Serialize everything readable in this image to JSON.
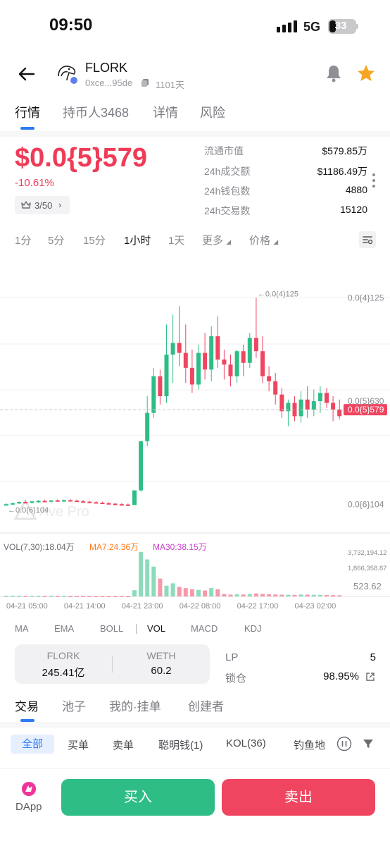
{
  "status_bar": {
    "time": "09:50",
    "network": "5G",
    "battery": "33"
  },
  "header": {
    "token_name": "FLORK",
    "address": "0xce...95de",
    "age": "1101天",
    "icons": {
      "back": "back-arrow-icon",
      "bell": "bell-icon",
      "star": "star-icon",
      "copy": "copy-icon"
    },
    "star_color": "#f5a623"
  },
  "tabs": [
    "行情",
    "持币人3468",
    "详情",
    "风险"
  ],
  "price": {
    "value": "$0.0{5}579",
    "change": "-10.61%",
    "rank": "3/50"
  },
  "stats": [
    {
      "label": "流通市值",
      "value": "$579.85万"
    },
    {
      "label": "24h成交额",
      "value": "$1186.49万"
    },
    {
      "label": "24h钱包数",
      "value": "4880"
    },
    {
      "label": "24h交易数",
      "value": "15120"
    }
  ],
  "intervals": [
    "1分",
    "5分",
    "15分",
    "1小时",
    "1天",
    "更多",
    "价格"
  ],
  "active_interval": "1小时",
  "chart_data": {
    "type": "candlestick",
    "watermark": "Ave Pro",
    "colors": {
      "up": "#2ebd85",
      "down": "#ef4560",
      "last_price": "#ef4560"
    },
    "price_axis_labels": [
      "0.0{4}125",
      "0.0{5}630",
      "0.0{6}104"
    ],
    "price_axis_values": [
      1.25e-05,
      6.3e-06,
      1.04e-07
    ],
    "price_range": [
      -1.1e-06,
      1.43e-05
    ],
    "last_price_label": "0.0{5}579",
    "last_price": 5.79e-06,
    "max_marker": "←0.0(4)125",
    "min_marker": "←0.0(6)104",
    "volume_legend": {
      "vol": "VOL(7,30):18.04万",
      "ma7": "MA7:24.36万",
      "ma30": "MA30:38.15万",
      "ma7_color": "#ff7a1a",
      "ma30_color": "#c840c8"
    },
    "volume_axis_labels": [
      "3,732,194.12",
      "1,866,358.87",
      "523.62"
    ],
    "volume_axis_values": [
      3732194.12,
      1866358.87,
      523.62
    ],
    "volume_max": 3900000,
    "x_labels": [
      "04-21 05:00",
      "04-21 14:00",
      "04-21 23:00",
      "04-22 08:00",
      "04-22 17:00",
      "04-23 02:00"
    ],
    "x_label_index": [
      0,
      9,
      18,
      27,
      36,
      45
    ],
    "candles": [
      {
        "o": 1.04e-07,
        "h": 1.8e-07,
        "l": 4e-08,
        "c": 1.2e-07,
        "v": 45000
      },
      {
        "o": 1.2e-07,
        "h": 2.2e-07,
        "l": 8e-08,
        "c": 1.8e-07,
        "v": 52000
      },
      {
        "o": 1.8e-07,
        "h": 2.8e-07,
        "l": 1.2e-07,
        "c": 2.5e-07,
        "v": 48000
      },
      {
        "o": 2.5e-07,
        "h": 3.3e-07,
        "l": 1.6e-07,
        "c": 2.1e-07,
        "v": 41000
      },
      {
        "o": 2.1e-07,
        "h": 3.2e-07,
        "l": 1.5e-07,
        "c": 2.9e-07,
        "v": 56000
      },
      {
        "o": 2.9e-07,
        "h": 3.7e-07,
        "l": 2.1e-07,
        "c": 3.2e-07,
        "v": 44000
      },
      {
        "o": 3.2e-07,
        "h": 3.9e-07,
        "l": 2.4e-07,
        "c": 2.7e-07,
        "v": 39000
      },
      {
        "o": 2.7e-07,
        "h": 3.7e-07,
        "l": 2e-07,
        "c": 3.5e-07,
        "v": 42000
      },
      {
        "o": 3.5e-07,
        "h": 4.1e-07,
        "l": 2.6e-07,
        "c": 3.1e-07,
        "v": 40000
      },
      {
        "o": 3.1e-07,
        "h": 4e-07,
        "l": 2.4e-07,
        "c": 3.6e-07,
        "v": 43000
      },
      {
        "o": 3.6e-07,
        "h": 4.2e-07,
        "l": 2.9e-07,
        "c": 3.3e-07,
        "v": 38000
      },
      {
        "o": 3.3e-07,
        "h": 4e-07,
        "l": 2.6e-07,
        "c": 3e-07,
        "v": 36000
      },
      {
        "o": 3e-07,
        "h": 3.6e-07,
        "l": 2.3e-07,
        "c": 2.7e-07,
        "v": 35000
      },
      {
        "o": 2.7e-07,
        "h": 3.3e-07,
        "l": 2e-07,
        "c": 2.4e-07,
        "v": 33000
      },
      {
        "o": 2.4e-07,
        "h": 3e-07,
        "l": 1.8e-07,
        "c": 2.1e-07,
        "v": 32000
      },
      {
        "o": 2.1e-07,
        "h": 2.7e-07,
        "l": 1.5e-07,
        "c": 1.8e-07,
        "v": 31000
      },
      {
        "o": 1.8e-07,
        "h": 2.4e-07,
        "l": 1.2e-07,
        "c": 1.5e-07,
        "v": 30000
      },
      {
        "o": 1.5e-07,
        "h": 2.1e-07,
        "l": 9e-08,
        "c": 1.2e-07,
        "v": 29000
      },
      {
        "o": 1.2e-07,
        "h": 1.8e-07,
        "l": 7e-08,
        "c": 9e-08,
        "v": 28000
      },
      {
        "o": 1e-07,
        "h": 1.6e-07,
        "l": 5e-08,
        "c": 7e-08,
        "v": 27000
      },
      {
        "o": 7e-08,
        "h": 1.3e-07,
        "l": 1.04e-07,
        "c": 9.5e-07,
        "v": 520000
      },
      {
        "o": 9.5e-07,
        "h": 1.4e-06,
        "l": 8.7e-07,
        "c": 3.9e-06,
        "v": 3732194
      },
      {
        "o": 3.9e-06,
        "h": 6.6e-06,
        "l": 3.6e-06,
        "c": 5.6e-06,
        "v": 3100000
      },
      {
        "o": 5.6e-06,
        "h": 8.3e-06,
        "l": 5.3e-06,
        "c": 7.8e-06,
        "v": 2500000
      },
      {
        "o": 7.8e-06,
        "h": 8.2e-06,
        "l": 6.1e-06,
        "c": 6.6e-06,
        "v": 1500000
      },
      {
        "o": 6.6e-06,
        "h": 1.09e-05,
        "l": 6.2e-06,
        "c": 9.1e-06,
        "v": 900000
      },
      {
        "o": 9.1e-06,
        "h": 1.15e-05,
        "l": 7.4e-06,
        "c": 9.8e-06,
        "v": 1100000
      },
      {
        "o": 9.8e-06,
        "h": 1.2e-05,
        "l": 8.4e-06,
        "c": 9.2e-06,
        "v": 800000
      },
      {
        "o": 9.2e-06,
        "h": 1.09e-05,
        "l": 7.4e-06,
        "c": 8.3e-06,
        "v": 700000
      },
      {
        "o": 8.3e-06,
        "h": 9.4e-06,
        "l": 6.8e-06,
        "c": 7.3e-06,
        "v": 600000
      },
      {
        "o": 7.3e-06,
        "h": 9.7e-06,
        "l": 7e-06,
        "c": 9.2e-06,
        "v": 550000
      },
      {
        "o": 9.2e-06,
        "h": 1.04e-05,
        "l": 7.6e-06,
        "c": 8.2e-06,
        "v": 500000
      },
      {
        "o": 8.2e-06,
        "h": 1.08e-05,
        "l": 7.5e-06,
        "c": 1.02e-05,
        "v": 700000
      },
      {
        "o": 1.02e-05,
        "h": 1.14e-05,
        "l": 8.3e-06,
        "c": 8.8e-06,
        "v": 600000
      },
      {
        "o": 8.8e-06,
        "h": 9.4e-06,
        "l": 7.6e-06,
        "c": 8.5e-06,
        "v": 200000
      },
      {
        "o": 8.5e-06,
        "h": 9.1e-06,
        "l": 7.2e-06,
        "c": 7.8e-06,
        "v": 150000
      },
      {
        "o": 7.8e-06,
        "h": 9.4e-06,
        "l": 7.4e-06,
        "c": 9.3e-06,
        "v": 180000
      },
      {
        "o": 9.3e-06,
        "h": 9.7e-06,
        "l": 7.8e-06,
        "c": 8.6e-06,
        "v": 160000
      },
      {
        "o": 8.6e-06,
        "h": 1.04e-05,
        "l": 8.3e-06,
        "c": 1.01e-05,
        "v": 200000
      },
      {
        "o": 1.01e-05,
        "h": 1.25e-05,
        "l": 8.9e-06,
        "c": 9.3e-06,
        "v": 250000
      },
      {
        "o": 9.3e-06,
        "h": 1.02e-05,
        "l": 7.4e-06,
        "c": 7.8e-06,
        "v": 210000
      },
      {
        "o": 7.8e-06,
        "h": 8.4e-06,
        "l": 6.9e-06,
        "c": 7.5e-06,
        "v": 180000
      },
      {
        "o": 7.5e-06,
        "h": 8e-06,
        "l": 6.1e-06,
        "c": 6.7e-06,
        "v": 160000
      },
      {
        "o": 6.7e-06,
        "h": 7.1e-06,
        "l": 5.3e-06,
        "c": 5.7e-06,
        "v": 150000
      },
      {
        "o": 5.7e-06,
        "h": 6.4e-06,
        "l": 4.8e-06,
        "c": 6.2e-06,
        "v": 140000
      },
      {
        "o": 6.2e-06,
        "h": 6.6e-06,
        "l": 5.1e-06,
        "c": 5.4e-06,
        "v": 130000
      },
      {
        "o": 5.4e-06,
        "h": 6.9e-06,
        "l": 5e-06,
        "c": 6.4e-06,
        "v": 160000
      },
      {
        "o": 6.4e-06,
        "h": 7.2e-06,
        "l": 5.3e-06,
        "c": 5.8e-06,
        "v": 150000
      },
      {
        "o": 5.8e-06,
        "h": 7e-06,
        "l": 5.4e-06,
        "c": 6.3e-06,
        "v": 140000
      },
      {
        "o": 6.3e-06,
        "h": 7.2e-06,
        "l": 5.6e-06,
        "c": 6.8e-06,
        "v": 130000
      },
      {
        "o": 6.8e-06,
        "h": 7.1e-06,
        "l": 5.9e-06,
        "c": 6.2e-06,
        "v": 120000
      },
      {
        "o": 6.2e-06,
        "h": 6.6e-06,
        "l": 5.1e-06,
        "c": 5.8e-06,
        "v": 110000
      },
      {
        "o": 5.8e-06,
        "h": 6.4e-06,
        "l": 5.2e-06,
        "c": 5.4e-06,
        "v": 100000
      }
    ]
  },
  "indicators": [
    "MA",
    "EMA",
    "BOLL",
    "VOL",
    "MACD",
    "KDJ"
  ],
  "active_indicator": "VOL",
  "pool": {
    "token_symbol": "FLORK",
    "token_amount": "245.41亿",
    "quote_symbol": "WETH",
    "quote_amount": "60.2",
    "lp_label": "LP",
    "lp_value": "5",
    "lock_label": "锁仓",
    "lock_value": "98.95%"
  },
  "trade_tabs": [
    "交易",
    "池子",
    "我的·挂单",
    "创建者"
  ],
  "filters": [
    "全部",
    "买单",
    "卖单",
    "聪明钱(1)",
    "KOL(36)",
    "钓鱼地"
  ],
  "bottom": {
    "dapp": "DApp",
    "buy": "买入",
    "sell": "卖出"
  }
}
